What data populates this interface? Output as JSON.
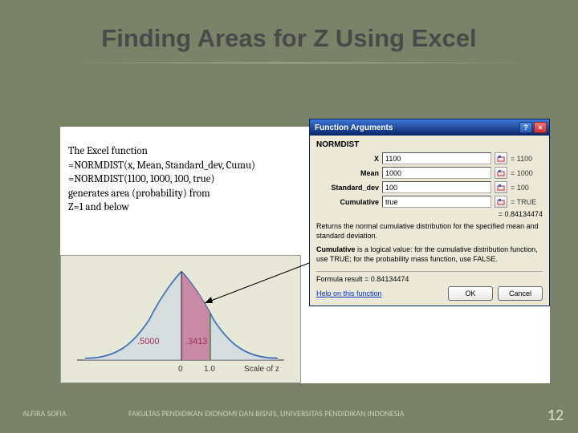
{
  "title": "Finding Areas for Z Using Excel",
  "description": {
    "line1": "The Excel function",
    "line2": "=NORMDIST(x, Mean, Standard_dev, Cumu)",
    "line3": "=NORMDIST(1100, 1000, 100, true)",
    "line4": "generates area (probability) from",
    "line5": "Z=1 and below"
  },
  "chart_data": {
    "type": "area",
    "title": "",
    "xlabel": "Scale of z",
    "ylabel": "",
    "xlim": [
      -3,
      3
    ],
    "annotations": [
      {
        "text": ".5000",
        "region": "left_of_mean"
      },
      {
        "text": ".3413",
        "region": "0_to_1"
      }
    ],
    "x_ticks": [
      0,
      1.0
    ],
    "shaded": {
      "from": 0,
      "to": 1.0
    }
  },
  "dialog": {
    "title": "Function Arguments",
    "function_name": "NORMDIST",
    "args": [
      {
        "label": "X",
        "value": "1100",
        "refval": "= 1100"
      },
      {
        "label": "Mean",
        "value": "1000",
        "refval": "= 1000"
      },
      {
        "label": "Standard_dev",
        "value": "100",
        "refval": "= 100"
      },
      {
        "label": "Cumulative",
        "value": "true",
        "refval": "= TRUE"
      }
    ],
    "result": "= 0.84134474",
    "func_desc": "Returns the normal cumulative distribution for the specified mean and standard deviation.",
    "param_name": "Cumulative",
    "param_desc": "is a logical value: for the cumulative distribution function, use TRUE; for the probability mass function, use FALSE.",
    "formula_result_label": "Formula result =",
    "formula_result": "0.84134474",
    "help_link": "Help on this function",
    "ok": "OK",
    "cancel": "Cancel"
  },
  "footer": {
    "author": "ALFIRA SOFIA",
    "institution": "FAKULTAS PENDIDIKAN EKONOMI DAN BISNIS, UNIVERSITAS PENDIDIKAN INDONESIA",
    "page": "12"
  }
}
